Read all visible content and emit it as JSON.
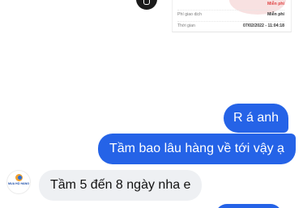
{
  "receipt": {
    "rows": [
      {
        "label": "",
        "value": "Miễn phí"
      },
      {
        "label": "Phí giao dịch",
        "value": "Miễn phí"
      },
      {
        "label": "Thời gian",
        "value": "07/02/2022 - 11:04:18"
      }
    ]
  },
  "messages": [
    {
      "direction": "outgoing",
      "text": "R á anh"
    },
    {
      "direction": "outgoing",
      "text": "Tầm bao lâu hàng về tới vậy ạ"
    },
    {
      "direction": "incoming",
      "text": "Tầm 5 đến 8 ngày nha e"
    }
  ],
  "sender": {
    "avatar_text": "MUA HỘ HÀNG NƯỚC NGOÀI"
  },
  "colors": {
    "outgoing_bubble": "#2563e7",
    "incoming_bubble": "#eef0f3",
    "receipt_accent": "#e04545"
  }
}
